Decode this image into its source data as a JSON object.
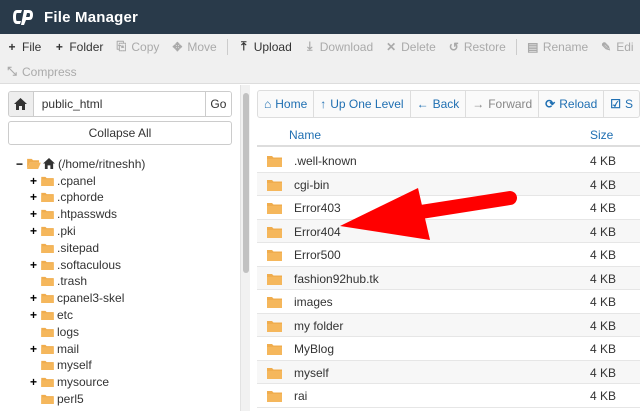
{
  "app": {
    "title": "File Manager",
    "logo_icon": "cpanel-logo-icon"
  },
  "toolbar": {
    "row1": [
      {
        "label": "File",
        "icon": "+",
        "disabled": false
      },
      {
        "label": "Folder",
        "icon": "+",
        "disabled": false
      },
      {
        "label": "Copy",
        "icon": "⎘",
        "disabled": true
      },
      {
        "label": "Move",
        "icon": "✥",
        "disabled": true
      },
      {
        "label": "Upload",
        "icon": "⤒",
        "disabled": false
      },
      {
        "label": "Download",
        "icon": "⤓",
        "disabled": true
      },
      {
        "label": "Delete",
        "icon": "✕",
        "disabled": true
      },
      {
        "label": "Restore",
        "icon": "↺",
        "disabled": true
      },
      {
        "label": "Rename",
        "icon": "▤",
        "disabled": true
      },
      {
        "label": "Edi",
        "icon": "✎",
        "disabled": true
      }
    ],
    "row2": [
      {
        "label": "Compress",
        "icon": "⤡",
        "disabled": true
      }
    ]
  },
  "left": {
    "path_value": "public_html",
    "go_label": "Go",
    "collapse_label": "Collapse All",
    "tree_root": "(/home/ritneshh)",
    "tree": [
      {
        "label": ".cpanel",
        "expandable": true
      },
      {
        "label": ".cphorde",
        "expandable": true
      },
      {
        "label": ".htpasswds",
        "expandable": true
      },
      {
        "label": ".pki",
        "expandable": true
      },
      {
        "label": ".sitepad",
        "expandable": false
      },
      {
        "label": ".softaculous",
        "expandable": true
      },
      {
        "label": ".trash",
        "expandable": false
      },
      {
        "label": "cpanel3-skel",
        "expandable": true
      },
      {
        "label": "etc",
        "expandable": true
      },
      {
        "label": "logs",
        "expandable": false
      },
      {
        "label": "mail",
        "expandable": true
      },
      {
        "label": "myself",
        "expandable": false
      },
      {
        "label": "mysource",
        "expandable": true
      },
      {
        "label": "perl5",
        "expandable": false
      }
    ]
  },
  "nav": [
    {
      "label": "Home",
      "icon": "⌂",
      "disabled": false
    },
    {
      "label": "Up One Level",
      "icon": "↑",
      "disabled": false
    },
    {
      "label": "Back",
      "icon": "←",
      "disabled": false
    },
    {
      "label": "Forward",
      "icon": "→",
      "disabled": true
    },
    {
      "label": "Reload",
      "icon": "⟳",
      "disabled": false
    },
    {
      "label": "S",
      "icon": "☑",
      "disabled": false
    }
  ],
  "table": {
    "headers": {
      "name": "Name",
      "size": "Size"
    },
    "rows": [
      {
        "name": ".well-known",
        "size": "4 KB"
      },
      {
        "name": "cgi-bin",
        "size": "4 KB"
      },
      {
        "name": "Error403",
        "size": "4 KB"
      },
      {
        "name": "Error404",
        "size": "4 KB"
      },
      {
        "name": "Error500",
        "size": "4 KB"
      },
      {
        "name": "fashion92hub.tk",
        "size": "4 KB"
      },
      {
        "name": "images",
        "size": "4 KB"
      },
      {
        "name": "my folder",
        "size": "4 KB"
      },
      {
        "name": "MyBlog",
        "size": "4 KB"
      },
      {
        "name": "myself",
        "size": "4 KB"
      },
      {
        "name": "rai",
        "size": "4 KB"
      }
    ]
  },
  "colors": {
    "header_bg": "#293a4a",
    "folder": "#f0ad4e",
    "link": "#1f6fb2",
    "annotation_arrow": "#ff0000"
  }
}
